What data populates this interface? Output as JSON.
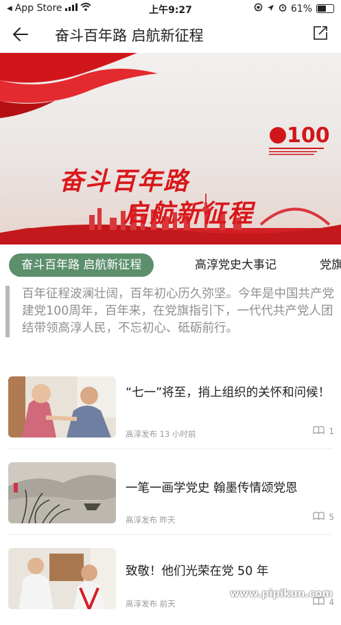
{
  "status": {
    "carrier": "App Store",
    "time": "上午9:27",
    "battery": "61%",
    "battery_level": 0.61
  },
  "nav": {
    "title": "奋斗百年路  启航新征程"
  },
  "banner": {
    "line1": "奋斗百年路",
    "line2": "启航新征程"
  },
  "tabs": [
    {
      "label": "奋斗百年路  启航新征程"
    },
    {
      "label": "高淳党史大事记"
    },
    {
      "label": "党旗"
    }
  ],
  "intro": "百年征程波澜壮阔，百年初心历久弥坚。今年是中国共产党建党100周年，百年来，在党旗指引下，一代代共产党人团结带领高淳人民，不忘初心、砥砺前行。",
  "articles": [
    {
      "title": "“七一”将至，捎上组织的关怀和问候！",
      "source": "高淳发布",
      "time": "13 小时前",
      "count": "1"
    },
    {
      "title": "一笔一画学党史  翰墨传情颂党恩",
      "source": "高淳发布",
      "time": "昨天",
      "count": "5"
    },
    {
      "title": "致敬！他们光荣在党 50 年",
      "source": "高淳发布",
      "time": "前天",
      "count": "4"
    }
  ],
  "watermark": "www.pipikun.com"
}
